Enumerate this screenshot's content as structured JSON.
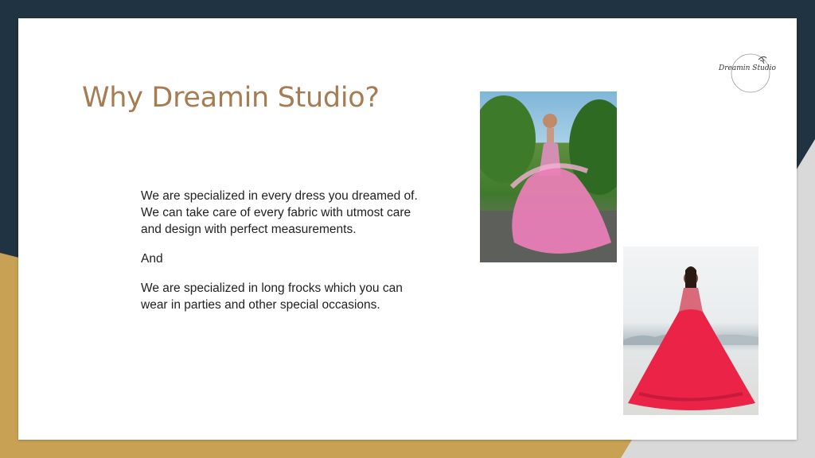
{
  "slide": {
    "title": "Why Dreamin Studio?",
    "paragraphs": [
      "We are specialized in every dress you dreamed of. We can take care of every fabric with utmost care and design with perfect measurements.",
      "And",
      "We are specialized in long frocks which you can wear in parties and other special occasions."
    ]
  },
  "logo": {
    "text": "Dreamin Studio",
    "icon": "leaf-branch-icon"
  },
  "images": {
    "photo1": "woman-in-pink-tulle-gown-photo",
    "photo2": "woman-in-red-flared-gown-photo"
  },
  "colors": {
    "title": "#a67c52",
    "background_dark": "#1f3342",
    "background_gold": "#c9a154",
    "slide": "#ffffff"
  }
}
